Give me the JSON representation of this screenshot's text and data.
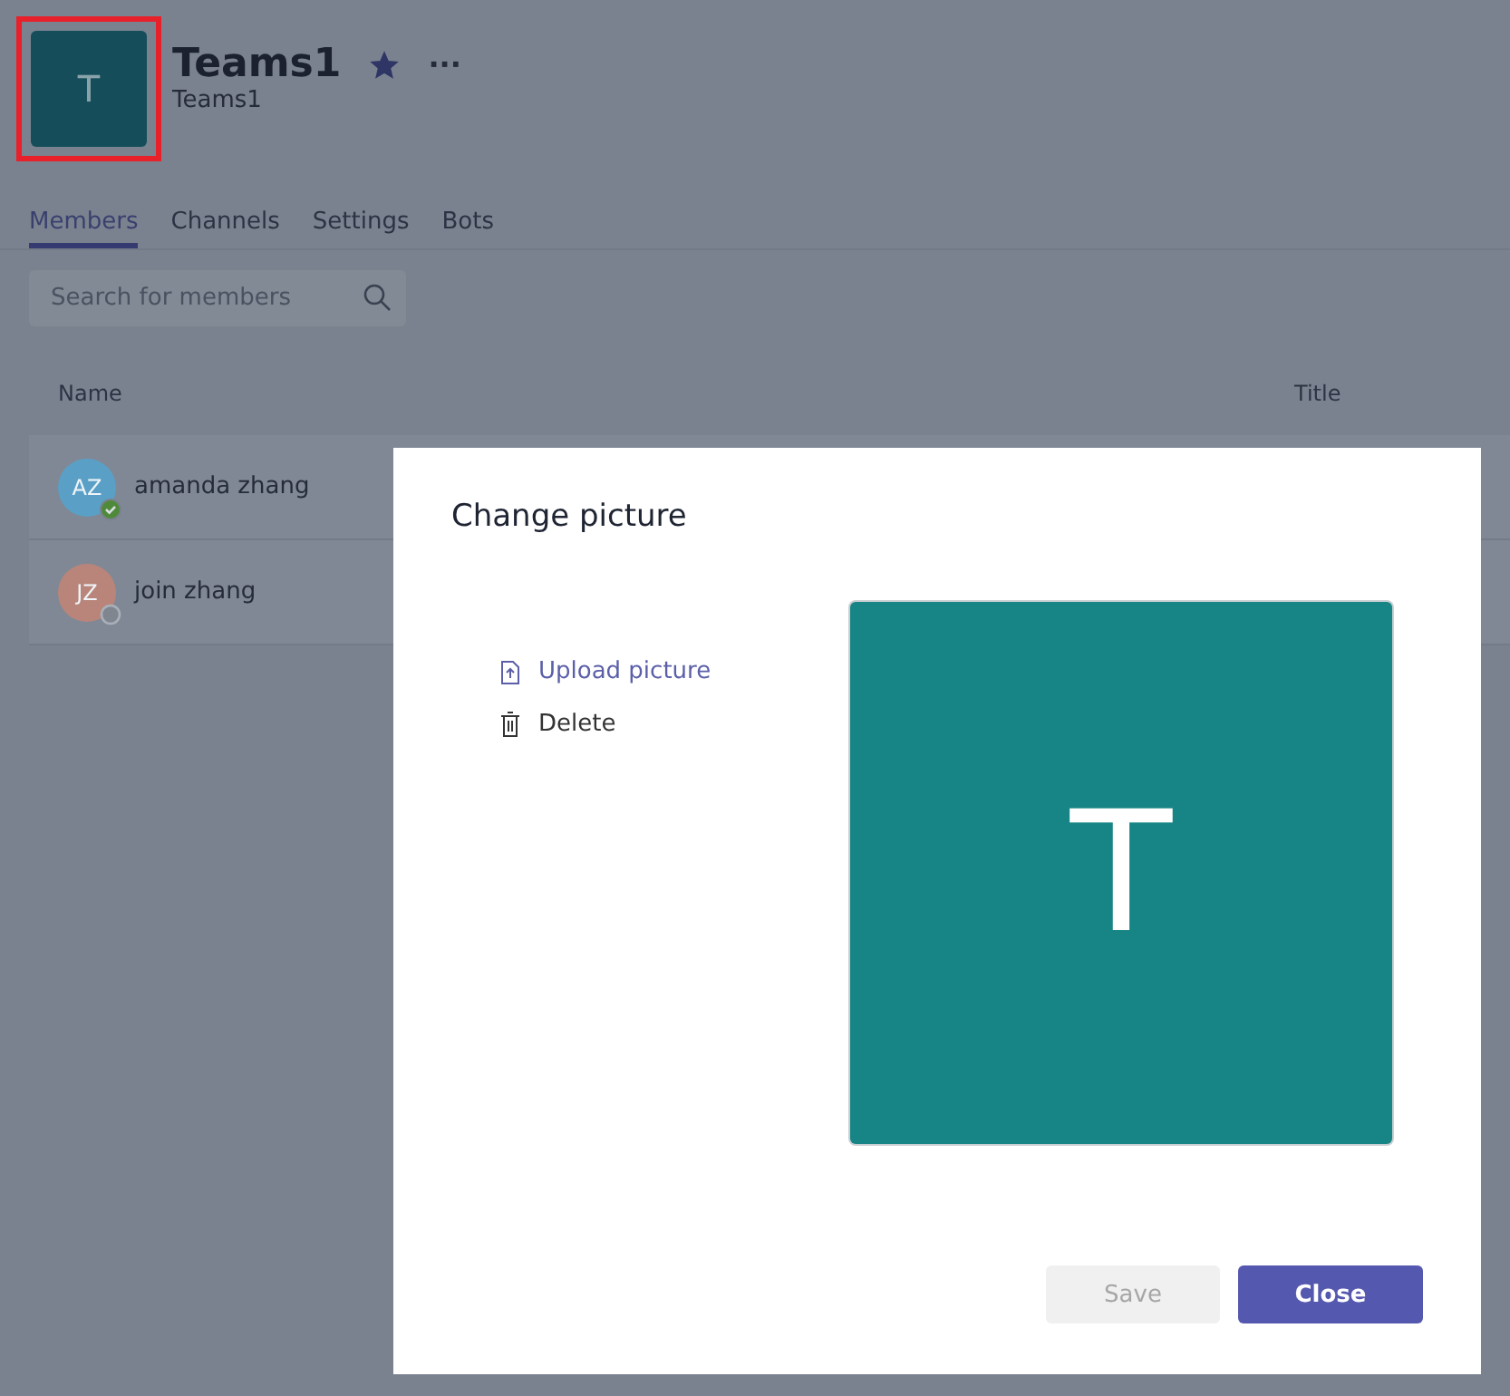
{
  "team": {
    "initial": "T",
    "name": "Teams1",
    "subtitle": "Teams1",
    "favorite": true,
    "more": "···",
    "highlighted": true
  },
  "tabs": [
    {
      "label": "Members",
      "selected": true
    },
    {
      "label": "Channels",
      "selected": false
    },
    {
      "label": "Settings",
      "selected": false
    },
    {
      "label": "Bots",
      "selected": false
    }
  ],
  "search": {
    "placeholder": "Search for members"
  },
  "table": {
    "columns": [
      "Name",
      "Title"
    ],
    "rows": [
      {
        "initials": "AZ",
        "name": "amanda zhang",
        "color": "#5aa0c6",
        "available": true
      },
      {
        "initials": "JZ",
        "name": "join zhang",
        "color": "#b9857a",
        "available": false
      }
    ]
  },
  "dialog": {
    "title": "Change picture",
    "actions": [
      {
        "kind": "upload",
        "label": "Upload picture"
      },
      {
        "kind": "delete",
        "label": "Delete"
      }
    ],
    "preview_initial": "T",
    "buttons": [
      {
        "label": "Save",
        "primary": false,
        "disabled": true
      },
      {
        "label": "Close",
        "primary": true,
        "disabled": false
      }
    ]
  }
}
